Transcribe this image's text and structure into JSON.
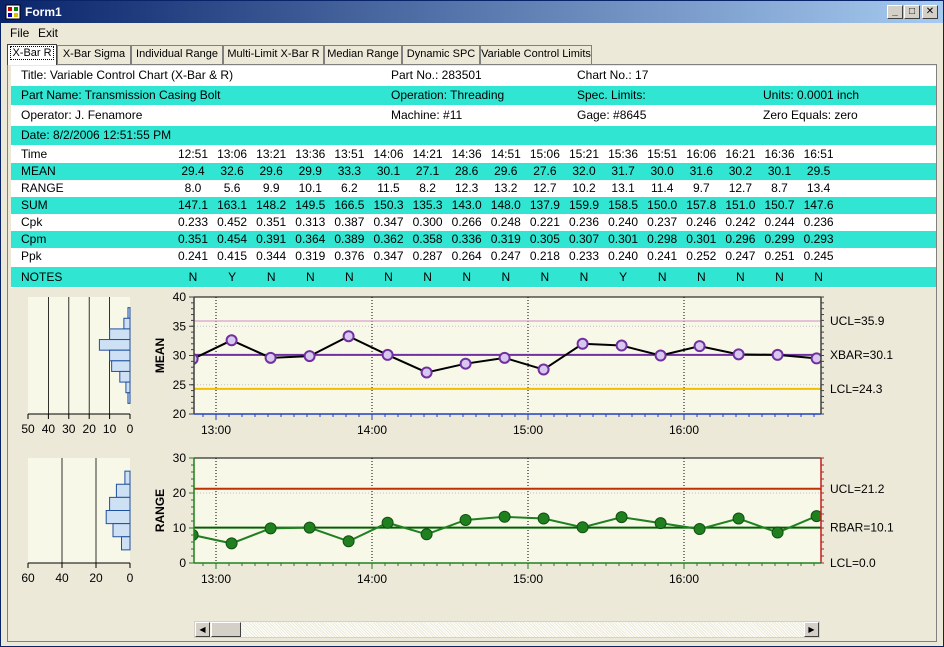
{
  "window": {
    "title": "Form1",
    "minimize": "_",
    "maximize": "□",
    "close": "✕"
  },
  "menu": [
    "File",
    "Exit"
  ],
  "tabs": [
    "X-Bar R",
    "X-Bar Sigma",
    "Individual Range",
    "Multi-Limit X-Bar R",
    "Median Range",
    "Dynamic SPC",
    "Variable Control Limits"
  ],
  "header": {
    "title": "Title: Variable Control Chart (X-Bar & R)",
    "part_no": "Part No.: 283501",
    "chart_no": "Chart No.: 17",
    "part_name": "Part Name: Transmission Casing Bolt",
    "operation": "Operation: Threading",
    "spec_limits": "Spec. Limits:",
    "units": "Units: 0.0001 inch",
    "operator": "Operator: J. Fenamore",
    "machine": "Machine: #11",
    "gage": "Gage: #8645",
    "zero_equals": "Zero Equals: zero",
    "date": "Date: 8/2/2006 12:51:55 PM"
  },
  "table": {
    "times": [
      "12:51",
      "13:06",
      "13:21",
      "13:36",
      "13:51",
      "14:06",
      "14:21",
      "14:36",
      "14:51",
      "15:06",
      "15:21",
      "15:36",
      "15:51",
      "16:06",
      "16:21",
      "16:36",
      "16:51"
    ],
    "rows": [
      {
        "label": "Time",
        "values": [
          "12:51",
          "13:06",
          "13:21",
          "13:36",
          "13:51",
          "14:06",
          "14:21",
          "14:36",
          "14:51",
          "15:06",
          "15:21",
          "15:36",
          "15:51",
          "16:06",
          "16:21",
          "16:36",
          "16:51"
        ]
      },
      {
        "label": "MEAN",
        "values": [
          "29.4",
          "32.6",
          "29.6",
          "29.9",
          "33.3",
          "30.1",
          "27.1",
          "28.6",
          "29.6",
          "27.6",
          "32.0",
          "31.7",
          "30.0",
          "31.6",
          "30.2",
          "30.1",
          "29.5"
        ]
      },
      {
        "label": "RANGE",
        "values": [
          "8.0",
          "5.6",
          "9.9",
          "10.1",
          "6.2",
          "11.5",
          "8.2",
          "12.3",
          "13.2",
          "12.7",
          "10.2",
          "13.1",
          "11.4",
          "9.7",
          "12.7",
          "8.7",
          "13.4"
        ]
      },
      {
        "label": "SUM",
        "values": [
          "147.1",
          "163.1",
          "148.2",
          "149.5",
          "166.5",
          "150.3",
          "135.3",
          "143.0",
          "148.0",
          "137.9",
          "159.9",
          "158.5",
          "150.0",
          "157.8",
          "151.0",
          "150.7",
          "147.6"
        ]
      },
      {
        "label": "Cpk",
        "values": [
          "0.233",
          "0.452",
          "0.351",
          "0.313",
          "0.387",
          "0.347",
          "0.300",
          "0.266",
          "0.248",
          "0.221",
          "0.236",
          "0.240",
          "0.237",
          "0.246",
          "0.242",
          "0.244",
          "0.236"
        ]
      },
      {
        "label": "Cpm",
        "values": [
          "0.351",
          "0.454",
          "0.391",
          "0.364",
          "0.389",
          "0.362",
          "0.358",
          "0.336",
          "0.319",
          "0.305",
          "0.307",
          "0.301",
          "0.298",
          "0.301",
          "0.296",
          "0.299",
          "0.293"
        ]
      },
      {
        "label": "Ppk",
        "values": [
          "0.241",
          "0.415",
          "0.344",
          "0.319",
          "0.376",
          "0.347",
          "0.287",
          "0.264",
          "0.247",
          "0.218",
          "0.233",
          "0.240",
          "0.241",
          "0.252",
          "0.247",
          "0.251",
          "0.245"
        ]
      },
      {
        "label": "NOTES",
        "values": [
          "N",
          "Y",
          "N",
          "N",
          "N",
          "N",
          "N",
          "N",
          "N",
          "N",
          "N",
          "Y",
          "N",
          "N",
          "N",
          "N",
          "N"
        ]
      }
    ]
  },
  "chart_data": [
    {
      "type": "line",
      "ylabel": "MEAN",
      "ylim": [
        20,
        40
      ],
      "yticks": [
        "20",
        "25",
        "30",
        "35",
        "40"
      ],
      "xticks": [
        "13:00",
        "14:00",
        "15:00",
        "16:00"
      ],
      "series": [
        {
          "values": [
            29.4,
            32.6,
            29.6,
            29.9,
            33.3,
            30.1,
            27.1,
            28.6,
            29.6,
            27.6,
            32.0,
            31.7,
            30.0,
            31.6,
            30.2,
            30.1,
            29.5
          ]
        }
      ],
      "limits": {
        "ucl": 35.9,
        "center": 30.1,
        "lcl": 24.3
      },
      "limit_labels": [
        "UCL=35.9",
        "XBAR=30.1",
        "LCL=24.3"
      ],
      "histogram": {
        "xticks": [
          "50",
          "40",
          "30",
          "20",
          "10",
          "0"
        ],
        "xlim": [
          50,
          0
        ],
        "bins": [
          0,
          1,
          3,
          10,
          15,
          10,
          9,
          5,
          2,
          1,
          0
        ]
      },
      "colors": {
        "line": "#000000",
        "marker_fill": "#d8c8f0",
        "marker_edge": "#7030a0",
        "center": "#7030a0",
        "ucl": "#d8a0c8",
        "lcl": "#f0c000"
      }
    },
    {
      "type": "line",
      "ylabel": "RANGE",
      "ylim": [
        0,
        30
      ],
      "yticks": [
        "0",
        "10",
        "20",
        "30"
      ],
      "xticks": [
        "13:00",
        "14:00",
        "15:00",
        "16:00"
      ],
      "series": [
        {
          "values": [
            8.0,
            5.6,
            9.9,
            10.1,
            6.2,
            11.5,
            8.2,
            12.3,
            13.2,
            12.7,
            10.2,
            13.1,
            11.4,
            9.7,
            12.7,
            8.7,
            13.4
          ]
        }
      ],
      "limits": {
        "ucl": 21.2,
        "center": 10.1,
        "lcl": 0.0
      },
      "limit_labels": [
        "UCL=21.2",
        "RBAR=10.1",
        "LCL=0.0"
      ],
      "histogram": {
        "xticks": [
          "60",
          "40",
          "20",
          "0"
        ],
        "xlim": [
          60,
          0
        ],
        "bins": [
          0,
          3,
          8,
          12,
          14,
          10,
          5,
          0
        ]
      },
      "colors": {
        "line": "#208020",
        "marker": "#208020",
        "center": "#006000",
        "ucl": "#c03000"
      }
    }
  ]
}
